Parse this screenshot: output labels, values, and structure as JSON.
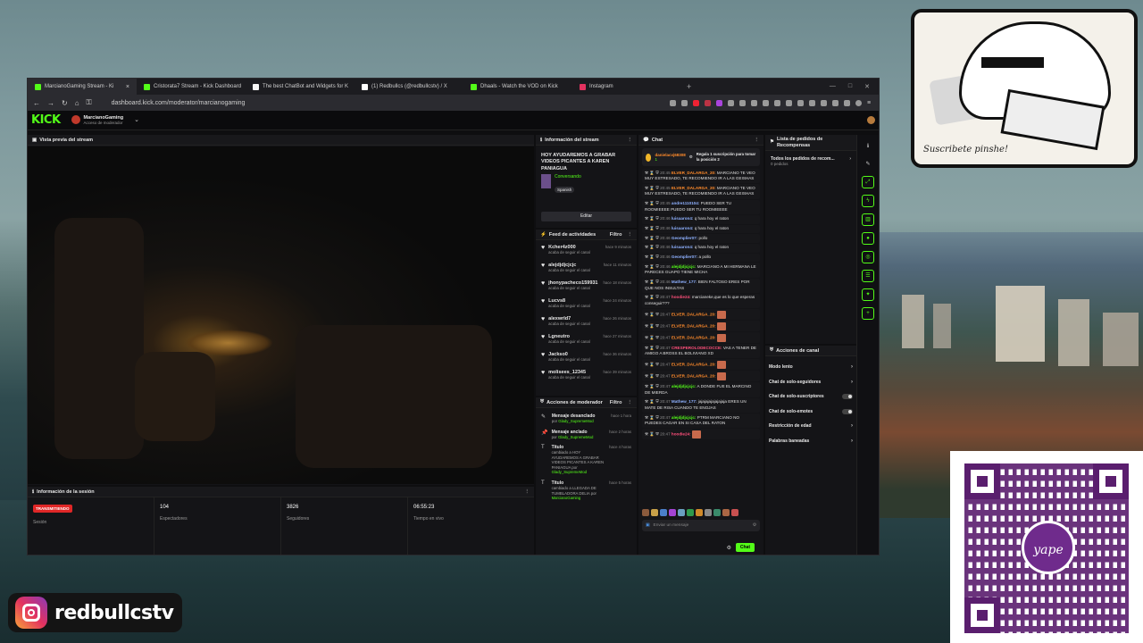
{
  "browser": {
    "tabs": [
      {
        "label": "MarcianoGaming Stream - Ki",
        "color": "#53fc18",
        "active": true
      },
      {
        "label": "Cristorata7 Stream - Kick Dashboard",
        "color": "#53fc18"
      },
      {
        "label": "The best ChatBot and Widgets for K",
        "color": "#f6f6f6"
      },
      {
        "label": "(1) Redbullcs (@redbullcstv) / X",
        "color": "#ffffff"
      },
      {
        "label": "Dhaals - Watch the VOD on Kick",
        "color": "#53fc18"
      },
      {
        "label": "Instagram",
        "color": "#e3325f"
      }
    ],
    "url": "dashboard.kick.com/moderator/marcianogaming"
  },
  "kick": {
    "logo": "KICK",
    "channel": "MarcianoGaming",
    "role": "Acceso de moderador"
  },
  "preview": {
    "title": "Vista previa del stream"
  },
  "session": {
    "title": "Información de la sesión",
    "status": "TRANSMITIENDO",
    "status_label": "Sesión",
    "viewers": "104",
    "viewers_label": "Espectadores",
    "followers": "3826",
    "followers_label": "Seguidores",
    "time": "06:55:23",
    "time_label": "Tiempo en vivo"
  },
  "info": {
    "header": "Información del stream",
    "title": "HOY AYUDAREMOS A GRABAR VIDEOS PICANTES A KAREN PANIAGUA",
    "category": "Conversando",
    "language": "Spanish",
    "edit": "Editar"
  },
  "activity": {
    "header": "Feed de actividades",
    "filter": "Filtro",
    "items": [
      {
        "name": "Kcher4z000",
        "sub": "acaba de seguir el canal",
        "time": "hace 9 minutos"
      },
      {
        "name": "alejdjdjcjcjc",
        "sub": "acaba de seguir el canal",
        "time": "hace 11 minutos"
      },
      {
        "name": "jhonypacheco159931",
        "sub": "acaba de seguir el canal",
        "time": "hace 18 minutos"
      },
      {
        "name": "Lucvs8",
        "sub": "acaba de seguir el canal",
        "time": "hace 24 minutos"
      },
      {
        "name": "alexwrld7",
        "sub": "acaba de seguir el canal",
        "time": "hace 26 minutos"
      },
      {
        "name": "Lgneutro",
        "sub": "acaba de seguir el canal",
        "time": "hace 27 minutos"
      },
      {
        "name": "Jackso0",
        "sub": "acaba de seguir el canal",
        "time": "hace 36 minutos"
      },
      {
        "name": "molisees_12345",
        "sub": "acaba de seguir el canal",
        "time": "hace 39 minutos"
      }
    ]
  },
  "modactions": {
    "header": "Acciones de moderador",
    "filter": "Filtro",
    "items": [
      {
        "title": "Mensaje desanclado",
        "desc": "por",
        "user": "Glady_SupremeMod",
        "time": "hace 1 hora"
      },
      {
        "title": "Mensaje anclado",
        "desc": "por",
        "user": "Glady_SupremeMod",
        "time": "hace 2 horas"
      },
      {
        "title": "Título",
        "desc": "cambiado a HOY AYUDAREMOS A GRABAR VIDEOS PICANTES A KAREN PANIAGUA por",
        "user": "Glady_SupremeMod",
        "time": "hace 4 horas"
      },
      {
        "title": "Título",
        "desc": "cambiado a LLEGADA DE TUMBLADORA DELIA por",
        "user": "MarcianoGaming",
        "time": "hace 5 horas"
      }
    ]
  },
  "chat": {
    "header": "Chat",
    "pin_user": "danielacvj68308",
    "pin_count": "1",
    "pin_text": "Regala 1 suscripción para tomar la posición 2",
    "messages": [
      {
        "ts": "20:45",
        "user": "ELVER_DALARGA_20:",
        "cls": "u1",
        "text": "MARCIANO TE VEO MUY ESTRESADO, TE RECOMIENDO IR A LAS GEISHAS"
      },
      {
        "ts": "20:45",
        "user": "ELVER_DALARGA_20:",
        "cls": "u1",
        "text": "MARCIANO TE VEO MUY ESTRESADO, TE RECOMIENDO IR A LAS GEISHAS"
      },
      {
        "ts": "20:45",
        "user": "andre1110104:",
        "cls": "u2",
        "text": "PUEDO SER TU ROOMIEEEE PUEDO SER TU ROOMIEEEE"
      },
      {
        "ts": "20:46",
        "user": "luisaaron4:",
        "cls": "u2",
        "text": "q hara hoy el raton"
      },
      {
        "ts": "20:46",
        "user": "luisaaron4:",
        "cls": "u2",
        "text": "q hara hoy el raton"
      },
      {
        "ts": "20:46",
        "user": "Geomplier07:",
        "cls": "u2",
        "text": "pollo"
      },
      {
        "ts": "20:46",
        "user": "luisaaron4:",
        "cls": "u2",
        "text": "q hara hoy el raton"
      },
      {
        "ts": "20:46",
        "user": "Geomplier07:",
        "cls": "u2",
        "text": "a pollo"
      },
      {
        "ts": "20:46",
        "user": "alejdjdjcjcjc:",
        "cls": "u3",
        "text": "MARCIANO A MI HERMANA LE PARECES GUAPO TIENE MICHA"
      },
      {
        "ts": "20:46",
        "user": "Mathew_177:",
        "cls": "u2",
        "text": "BIEN FALTOSO ERES POR QUE NOS INSULTAS"
      },
      {
        "ts": "20:47",
        "user": "hoodie24:",
        "cls": "u4",
        "text": "marcianeke,que es lo que esperas conseguir???"
      },
      {
        "ts": "20:47",
        "user": "ELVER_DALARGA_20:",
        "cls": "u1",
        "text": ""
      },
      {
        "ts": "20:47",
        "user": "ELVER_DALARGA_20:",
        "cls": "u1",
        "text": ""
      },
      {
        "ts": "20:47",
        "user": "ELVER_DALARGA_20:",
        "cls": "u1",
        "text": ""
      },
      {
        "ts": "20:47",
        "user": "CRESPEROLODECOCCE:",
        "cls": "u4",
        "text": "VAS A TENER DE AMIGO A BROSS EL BOLIVIANO XD"
      },
      {
        "ts": "20:47",
        "user": "ELVER_DALARGA_20:",
        "cls": "u1",
        "text": ""
      },
      {
        "ts": "20:47",
        "user": "ELVER_DALARGA_20:",
        "cls": "u1",
        "text": ""
      },
      {
        "ts": "20:47",
        "user": "alejdjdjcjcjc:",
        "cls": "u3",
        "text": "A DONDE FUE EL MARCINO DE MIERDA"
      },
      {
        "ts": "20:47",
        "user": "Mathew_177:",
        "cls": "u2",
        "text": "jajajajajajajajaja ERES UN MATE DE RISA CUANDO TE ENOJAS"
      },
      {
        "ts": "20:47",
        "user": "alejdjdjcjcjc:",
        "cls": "u3",
        "text": "PTRM MARCIANO NO PUEDES CAGAR EN SI CASA DEL RATON"
      },
      {
        "ts": "20:47",
        "user": "hoodie24:",
        "cls": "u4",
        "text": ""
      }
    ],
    "input_placeholder": "Enviar un mensaje",
    "send": "Chat"
  },
  "rewards": {
    "header": "Lista de pedidos de Recompensas",
    "item": "Todos los pedidos de recom...",
    "sub": "0 pedidos"
  },
  "channel_actions": {
    "header": "Acciones de canal",
    "items": [
      {
        "label": "Modo lento",
        "type": "arrow"
      },
      {
        "label": "Chat de solo-seguidores",
        "type": "arrow"
      },
      {
        "label": "Chat de solo-suscriptores",
        "type": "toggle"
      },
      {
        "label": "Chat de solo-emotes",
        "type": "toggle"
      },
      {
        "label": "Restricción de edad",
        "type": "arrow"
      },
      {
        "label": "Palabras baneadas",
        "type": "arrow"
      }
    ]
  },
  "overlay": {
    "instagram": "redbullcstv",
    "signature": "Suscribete pinshe!"
  },
  "colors": {
    "kick_green": "#53fc18",
    "live_red": "#e02727"
  }
}
